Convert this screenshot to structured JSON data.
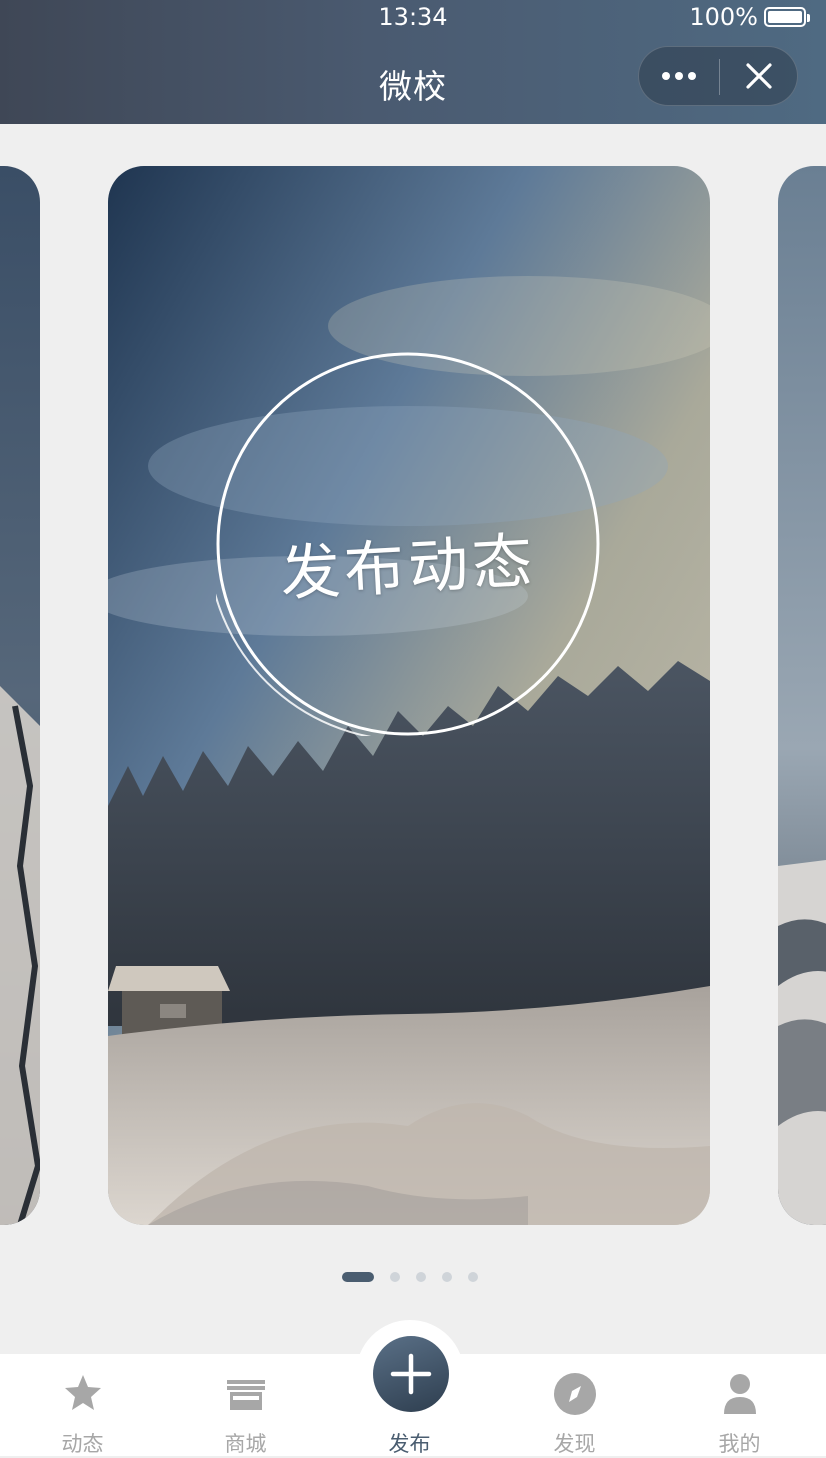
{
  "status_bar": {
    "time": "13:34",
    "battery": "100%"
  },
  "nav": {
    "title": "微校"
  },
  "card": {
    "label": "发布动态"
  },
  "carousel": {
    "pages": 5,
    "active_page": 1
  },
  "tabbar": {
    "items": [
      {
        "label": "动态",
        "icon": "star-icon",
        "active": false
      },
      {
        "label": "商城",
        "icon": "store-icon",
        "active": false
      },
      {
        "label": "发布",
        "icon": "plus-icon",
        "active": true
      },
      {
        "label": "发现",
        "icon": "compass-icon",
        "active": false
      },
      {
        "label": "我的",
        "icon": "user-icon",
        "active": false
      }
    ]
  },
  "colors": {
    "accent": "#4a5d70",
    "inactive": "#a7a7a7",
    "background": "#efefef"
  }
}
